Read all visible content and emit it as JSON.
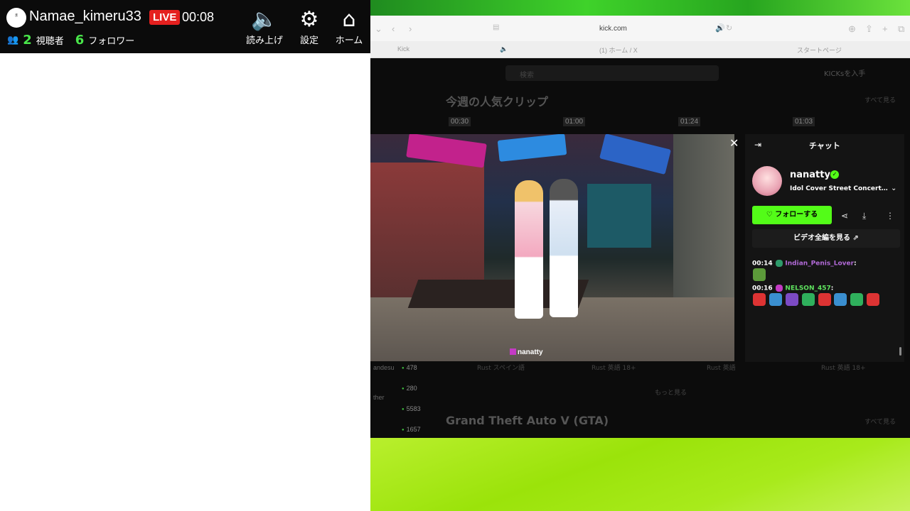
{
  "stream_tool": {
    "avatar_text": "ま",
    "username": "Namae_kimeru33",
    "live_badge": "LIVE",
    "elapsed": "00:08",
    "viewers_count": "2",
    "viewers_label": "視聴者",
    "followers_count": "6",
    "followers_label": "フォロワー",
    "tools": [
      {
        "label": "読み上げ",
        "icon": "speaker-icon"
      },
      {
        "label": "設定",
        "icon": "gear-icon"
      },
      {
        "label": "ホーム",
        "icon": "home-icon"
      }
    ]
  },
  "browser": {
    "url": "kick.com",
    "tabs": [
      "Kick",
      "(1) ホーム / X",
      "スタートページ"
    ]
  },
  "kick_page": {
    "search_placeholder": "検索",
    "get_kicks": "KICKsを入手",
    "section1_title": "今週の人気クリップ",
    "see_all": "すべて見る",
    "clip_durations": [
      "00:30",
      "01:00",
      "01:24",
      "01:03"
    ],
    "clip_tags": [
      "Rust  スペイン語",
      "Rust  英語  18+",
      "Rust  英語",
      "Rust  英語  18+"
    ],
    "more": "もっと見る",
    "section2_title": "Grand Theft Auto V (GTA)",
    "sidebar": [
      {
        "name": "andesu",
        "count": "478"
      },
      {
        "name": "",
        "count": "280"
      },
      {
        "name": "ther",
        "count": "5583"
      },
      {
        "name": "",
        "count": "1657"
      }
    ]
  },
  "player": {
    "watermark": "nanatty",
    "close": "✕"
  },
  "chat": {
    "title": "チャット",
    "channel_name": "nanatty",
    "stream_title": "Idol Cover Street Concert ...",
    "follow_button": "フォローする",
    "full_video_button": "ビデオ全編を見る",
    "messages": [
      {
        "time": "00:14",
        "user": "Indian_Penis_Lover",
        "color": "#b26ad8"
      },
      {
        "time": "00:16",
        "user": "NELSON_457",
        "color": "#5fe35f"
      }
    ]
  },
  "colors": {
    "kick_green": "#53fc18",
    "live_red": "#e5201f"
  }
}
